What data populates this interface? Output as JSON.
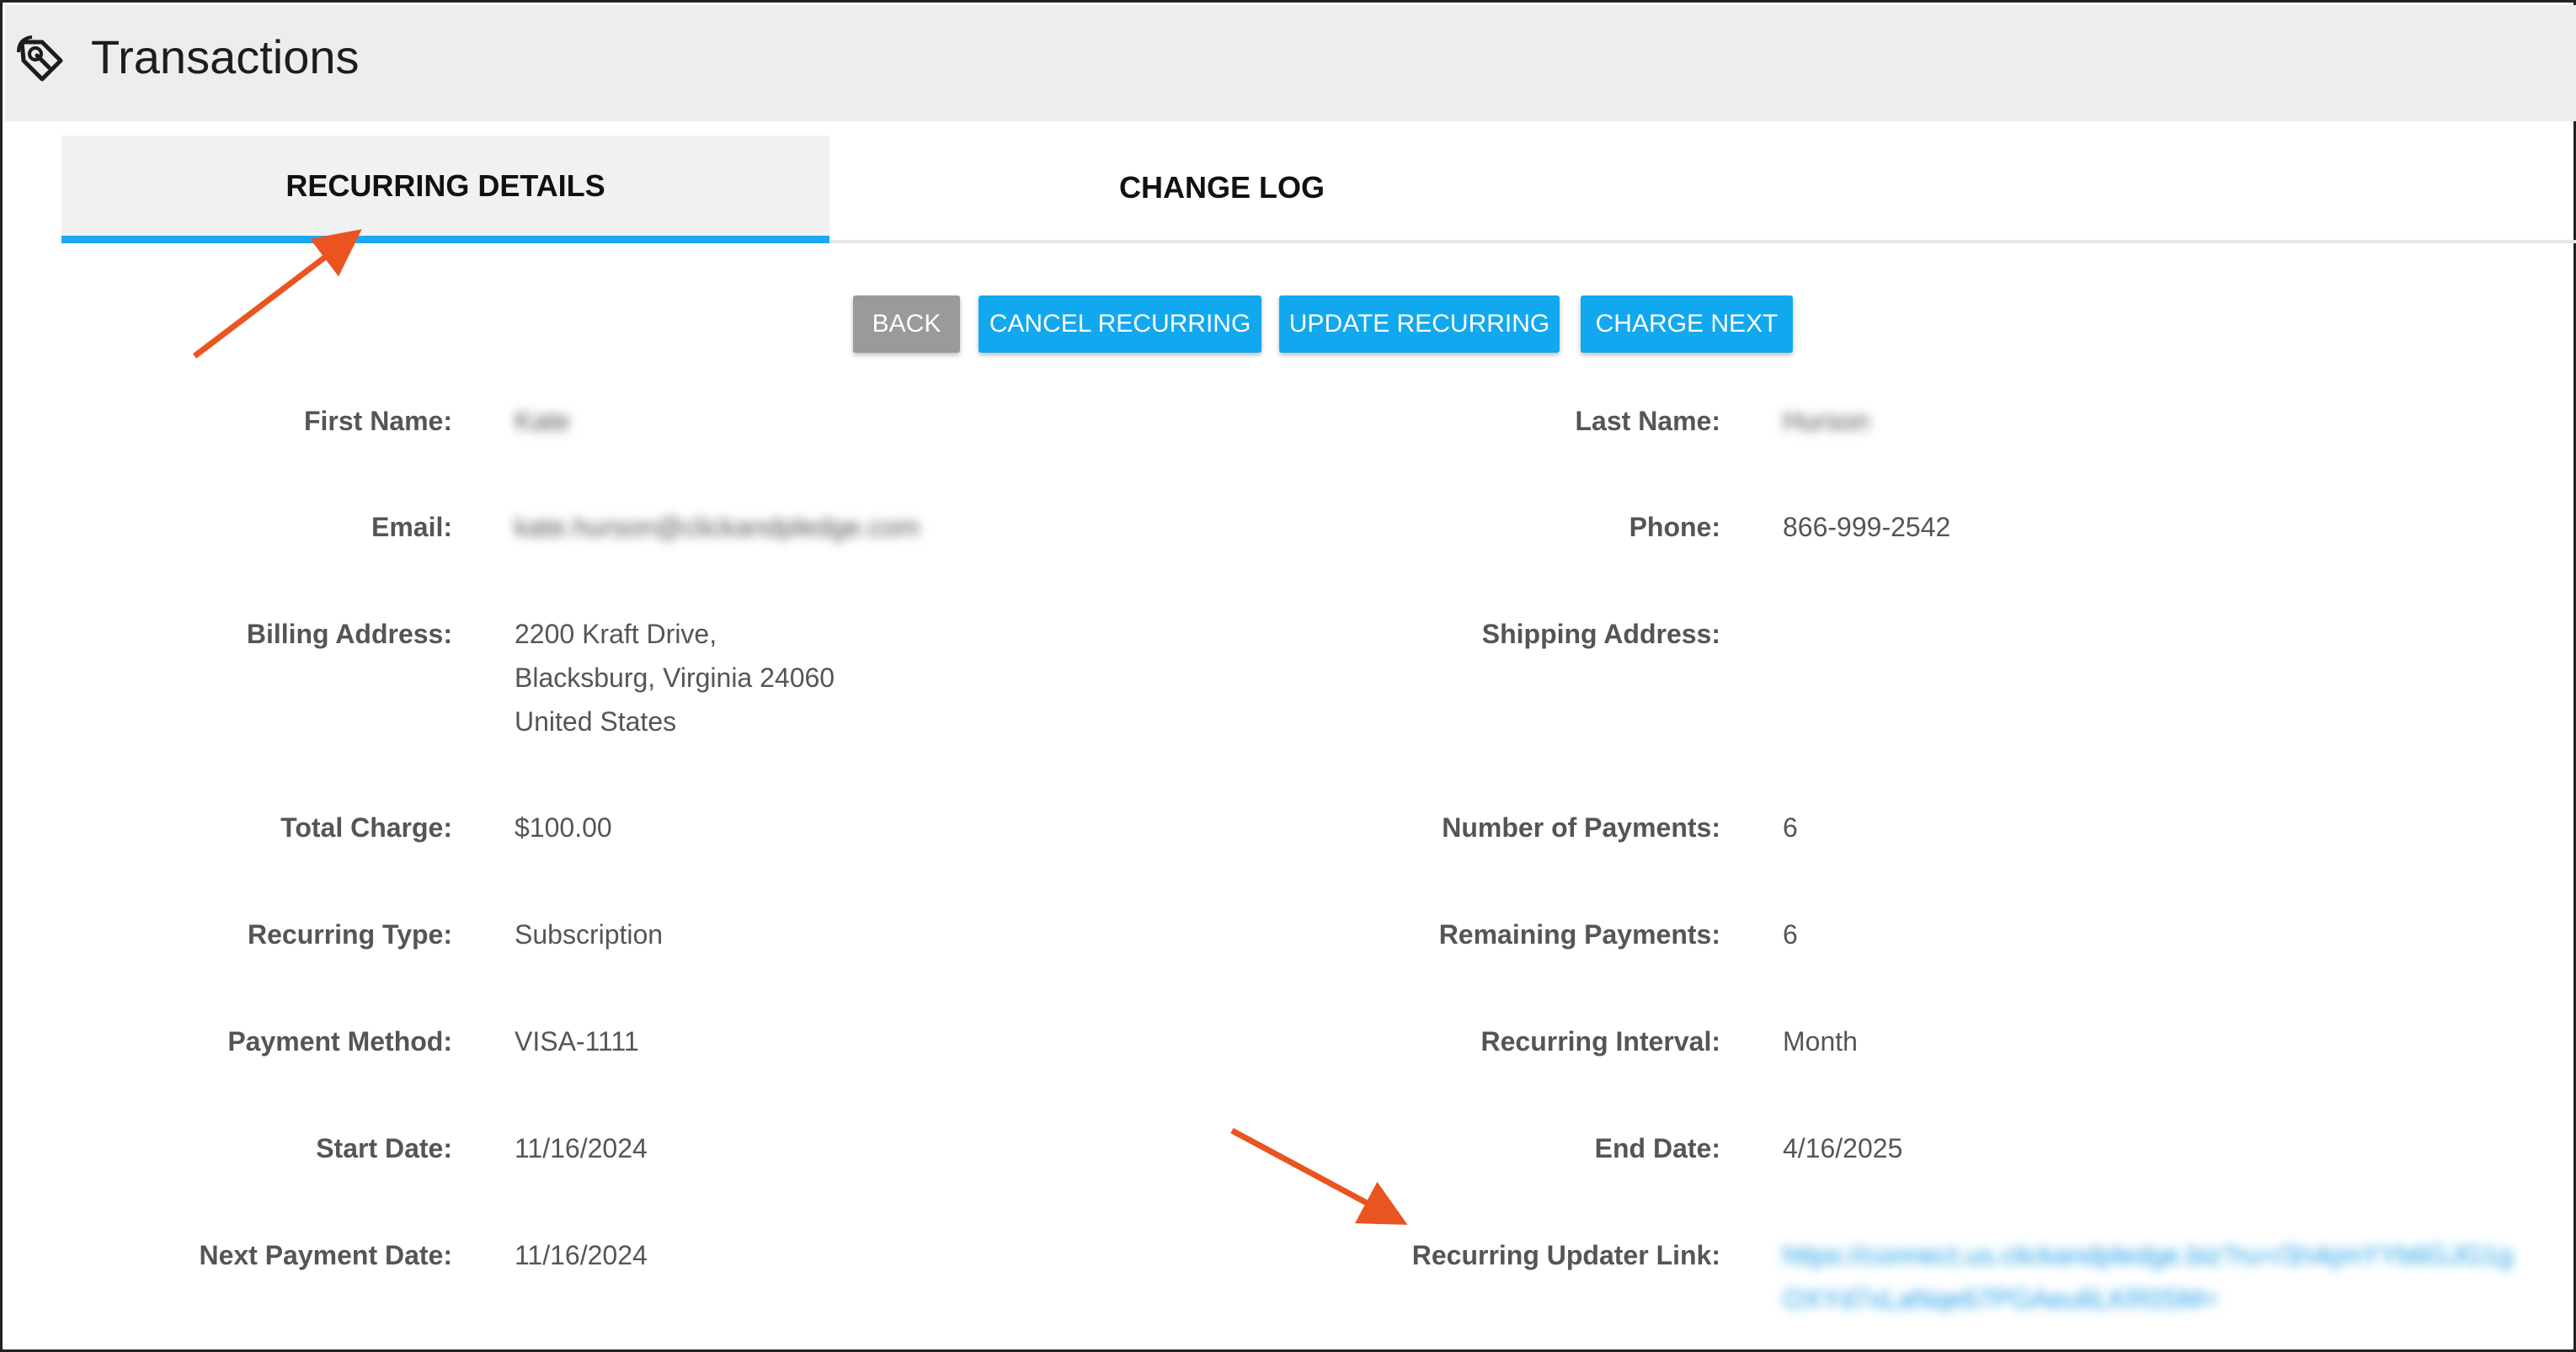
{
  "header": {
    "title": "Transactions",
    "icon": "transactions-tag-icon"
  },
  "tabs": [
    {
      "label": "RECURRING DETAILS",
      "active": true
    },
    {
      "label": "CHANGE LOG",
      "active": false
    }
  ],
  "buttons": {
    "back": "BACK",
    "cancel": "CANCEL RECURRING",
    "update": "UPDATE RECURRING",
    "charge": "CHARGE NEXT"
  },
  "details": {
    "first_name": {
      "label": "First Name:",
      "value": "Kate"
    },
    "last_name": {
      "label": "Last Name:",
      "value": "Hurson"
    },
    "email": {
      "label": "Email:",
      "value": "kate.hurson@clickandpledge.com"
    },
    "phone": {
      "label": "Phone:",
      "value": "866-999-2542"
    },
    "billing_address": {
      "label": "Billing Address:",
      "line1": "2200 Kraft Drive,",
      "line2": "Blacksburg, Virginia 24060",
      "line3": "United States"
    },
    "shipping_address": {
      "label": "Shipping Address:",
      "value": ""
    },
    "total_charge": {
      "label": "Total Charge:",
      "value": "$100.00"
    },
    "number_of_payments": {
      "label": "Number of Payments:",
      "value": "6"
    },
    "recurring_type": {
      "label": "Recurring Type:",
      "value": "Subscription"
    },
    "remaining_payments": {
      "label": "Remaining Payments:",
      "value": "6"
    },
    "payment_method": {
      "label": "Payment Method:",
      "value": "VISA-1111"
    },
    "recurring_interval": {
      "label": "Recurring Interval:",
      "value": "Month"
    },
    "start_date": {
      "label": "Start Date:",
      "value": "11/16/2024"
    },
    "end_date": {
      "label": "End Date:",
      "value": "4/16/2025"
    },
    "next_payment_date": {
      "label": "Next Payment Date:",
      "value": "11/16/2024"
    },
    "recurring_updater_link": {
      "label": "Recurring Updater Link:",
      "line1": "https://connect.us.clickandpledge.biz?ru=/3/vkjmYYb6GJG1g",
      "line2": "OXYd7xLaNqe67PGAeu6LKR0SM="
    }
  },
  "colors": {
    "accent": "#11a8ef",
    "tab_underline": "#1aa9f2",
    "back_button": "#9a9a9a",
    "annotation_arrow": "#ea5420"
  }
}
